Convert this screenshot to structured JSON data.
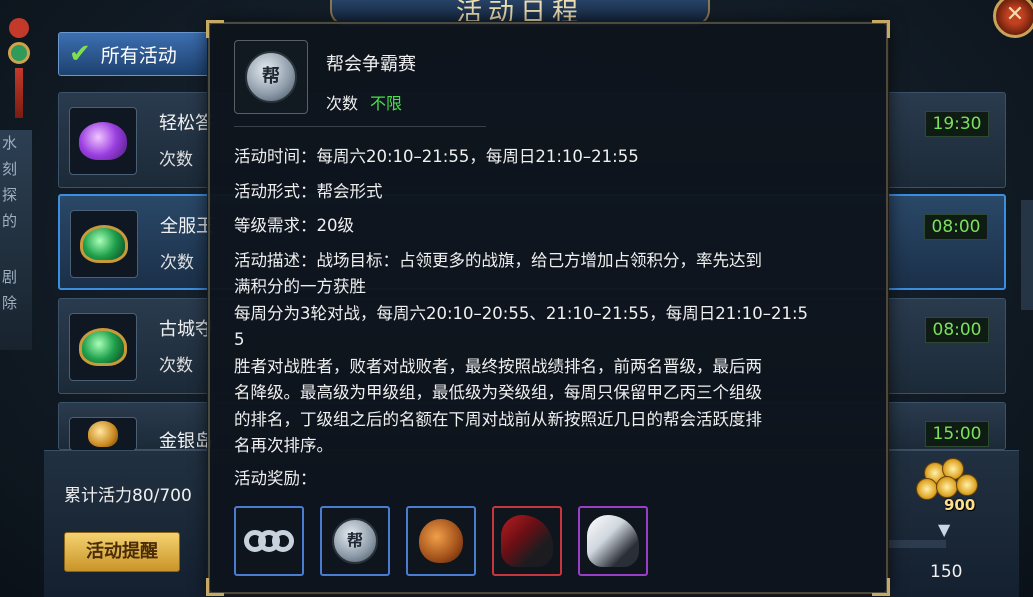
{
  "window": {
    "title": "活动日程",
    "close_glyph": "✕"
  },
  "side_text": [
    "水",
    "刻",
    "探",
    "的"
  ],
  "side_text_lower": [
    "剧",
    "除"
  ],
  "tabs": {
    "all_label": "所有活动"
  },
  "activities": [
    {
      "name": "轻松答",
      "count_label": "次数",
      "time": "19:30",
      "icon": "purple-gem-icon"
    },
    {
      "name": "全服王",
      "count_label": "次数",
      "time": "08:00",
      "icon": "green-jade-icon"
    },
    {
      "name": "古城夺",
      "count_label": "次数",
      "time": "08:00",
      "icon": "green-jade-icon"
    },
    {
      "name": "金银岛",
      "count_label": "",
      "time": "15:00",
      "icon": "gold-bag-icon"
    }
  ],
  "footer": {
    "vitality": "累计活力80/700",
    "remind_button": "活动提醒",
    "coin_amount": "900",
    "score": "150"
  },
  "tooltip": {
    "icon": "guild-medal-icon",
    "medal_char": "帮",
    "title": "帮会争霸赛",
    "count_label": "次数",
    "count_value": "不限",
    "time_line": "活动时间：每周六20:10–21:55，每周日21:10–21:55",
    "form_line": "活动形式：帮会形式",
    "level_line": "等级需求：20级",
    "desc_lines": [
      "活动描述：战场目标：占领更多的战旗，给己方增加占领积分，率先达到",
      "满积分的一方获胜",
      "每周分为3轮对战，每周六20:10–20:55、21:10–21:55，每周日21:10–21:5",
      "5",
      "胜者对战胜者，败者对战败者，最终按照战绩排名，前两名晋级，最后两",
      "名降级。最高级为甲级组，最低级为癸级组，每周只保留甲乙丙三个组级",
      "的排名，丁级组之后的名额在下周对战前从新按照近几日的帮会活跃度排",
      "名再次排序。"
    ],
    "rewards_label": "活动奖励：",
    "rewards": [
      {
        "icon": "silver-rings-icon",
        "rarity": "blue"
      },
      {
        "icon": "guild-medal-icon",
        "rarity": "blue"
      },
      {
        "icon": "treasure-bag-icon",
        "rarity": "blue"
      },
      {
        "icon": "red-horse-icon",
        "rarity": "red"
      },
      {
        "icon": "white-horse-icon",
        "rarity": "purple"
      }
    ]
  },
  "colors": {
    "accent_green": "#4be04a",
    "time_green": "#7be05a",
    "selected_border": "#3b8fe0"
  }
}
